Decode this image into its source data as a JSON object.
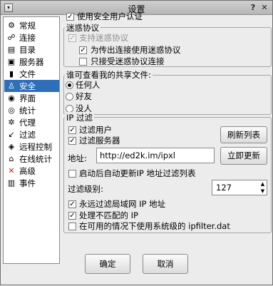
{
  "window": {
    "title": "设置"
  },
  "sidebar": {
    "items": [
      {
        "label": "常规",
        "icon": "general-icon",
        "glyph": "⚙"
      },
      {
        "label": "连接",
        "icon": "connection-icon",
        "glyph": "☍"
      },
      {
        "label": "目录",
        "icon": "folders-icon",
        "glyph": "▤"
      },
      {
        "label": "服务器",
        "icon": "server-icon",
        "glyph": "▣"
      },
      {
        "label": "文件",
        "icon": "files-icon",
        "glyph": "▮"
      },
      {
        "label": "安全",
        "icon": "security-icon",
        "glyph": "♙",
        "selected": true
      },
      {
        "label": "界面",
        "icon": "interface-icon",
        "glyph": "◉"
      },
      {
        "label": "统计",
        "icon": "statistics-icon",
        "glyph": "◎"
      },
      {
        "label": "代理",
        "icon": "proxy-icon",
        "glyph": "✲"
      },
      {
        "label": "过滤",
        "icon": "filter-icon",
        "glyph": "↙"
      },
      {
        "label": "远程控制",
        "icon": "remote-control-icon",
        "glyph": "◈"
      },
      {
        "label": "在线统计",
        "icon": "online-stats-icon",
        "glyph": "⌂"
      },
      {
        "label": "高级",
        "icon": "advanced-icon",
        "glyph": "✕"
      },
      {
        "label": "事件",
        "icon": "events-icon",
        "glyph": "▥"
      }
    ]
  },
  "security": {
    "use_secure_ident": {
      "label": "使用安全用户认证",
      "checked": true
    },
    "obfuscation": {
      "title": "迷惑协议",
      "support": {
        "label": "支持迷惑协议",
        "checked": true,
        "disabled": true
      },
      "outgoing": {
        "label": "为传出连接使用迷惑协议",
        "checked": true
      },
      "only_obfuscated": {
        "label": "只接受迷惑协议连接",
        "checked": false
      }
    },
    "shared_files": {
      "title": "谁可查看我的共享文件:",
      "options": [
        {
          "label": "任何人",
          "selected": true
        },
        {
          "label": "好友",
          "selected": false
        },
        {
          "label": "没人",
          "selected": false
        }
      ]
    },
    "ip_filter": {
      "title": "IP 过滤",
      "filter_clients": {
        "label": "过滤用户",
        "checked": true
      },
      "filter_servers": {
        "label": "过滤服务器",
        "checked": true
      },
      "reload_button": "刷新列表",
      "address_label": "地址:",
      "address_value": "http://ed2k.im/ipxl",
      "update_button": "立即更新",
      "auto_update": {
        "label": "启动后自动更新IP 地址过滤列表",
        "checked": false
      },
      "level_label": "过滤级别:",
      "level_value": "127",
      "filter_lan": {
        "label": "永远过滤局域网 IP 地址",
        "checked": true
      },
      "paranoid": {
        "label": "处理不匹配的 IP",
        "checked": true
      },
      "system_filter": {
        "label": "在可用的情况下使用系统级的 ipfilter.dat",
        "checked": false
      }
    }
  },
  "footer": {
    "ok": "确定",
    "cancel": "取消"
  }
}
